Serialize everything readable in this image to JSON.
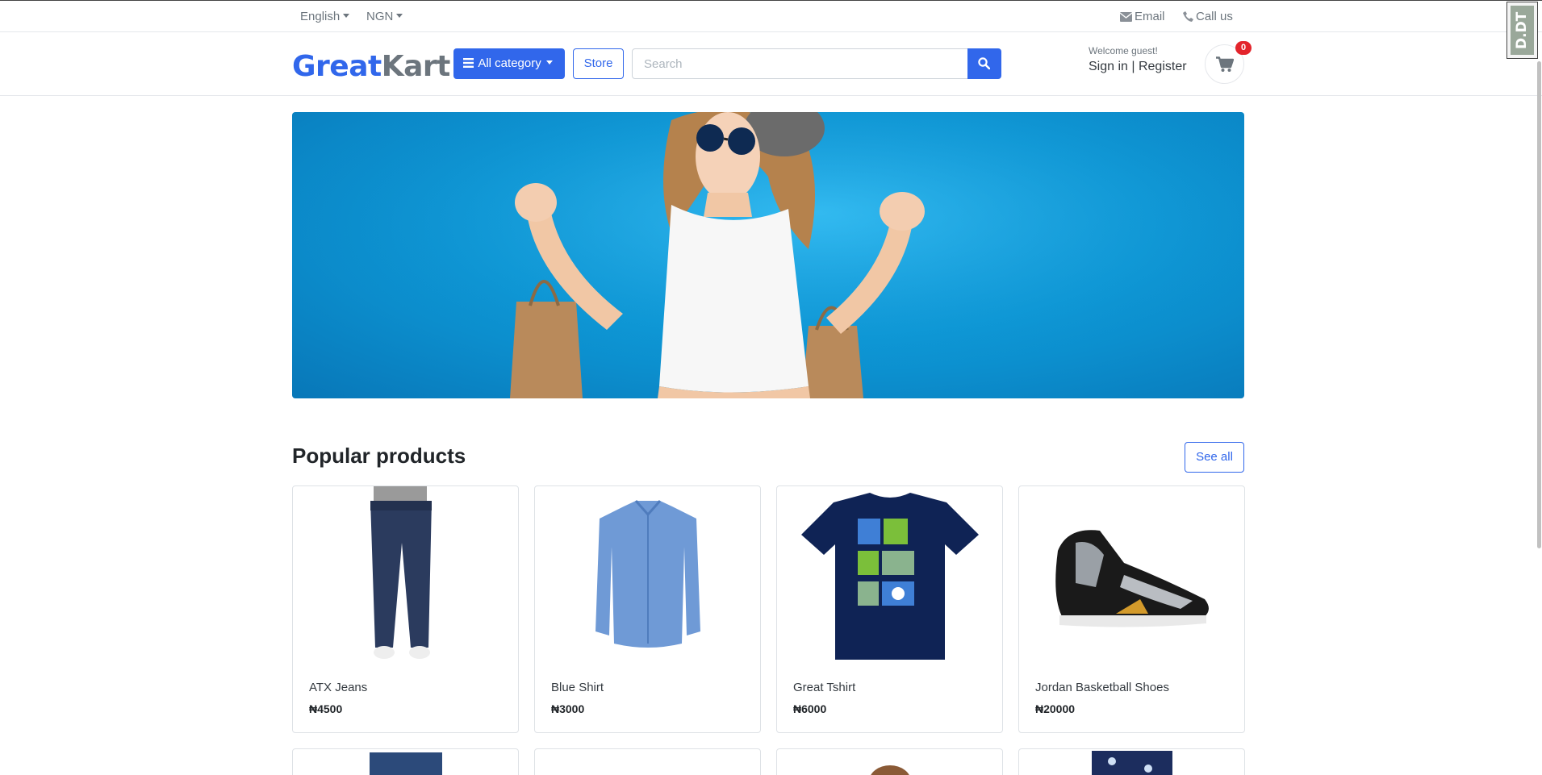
{
  "topbar": {
    "language": "English",
    "currency": "NGN",
    "email_label": "Email",
    "call_label": "Call us"
  },
  "header": {
    "logo_part1": "Great",
    "logo_part2": "Kart",
    "category_button": "All category",
    "store_button": "Store",
    "search_placeholder": "Search",
    "welcome": "Welcome guest!",
    "sign_in": "Sign in",
    "separator": " | ",
    "register": "Register",
    "cart_count": "0"
  },
  "overlay": {
    "badge_text": "D.DT"
  },
  "section": {
    "title": "Popular products",
    "see_all": "See all"
  },
  "products": [
    {
      "name": "ATX Jeans",
      "price": "₦4500"
    },
    {
      "name": "Blue Shirt",
      "price": "₦3000"
    },
    {
      "name": "Great Tshirt",
      "price": "₦6000"
    },
    {
      "name": "Jordan Basketball Shoes",
      "price": "₦20000"
    }
  ],
  "colors": {
    "primary": "#3167eb",
    "badge": "#e3242b",
    "banner": "#0e9ad8"
  }
}
